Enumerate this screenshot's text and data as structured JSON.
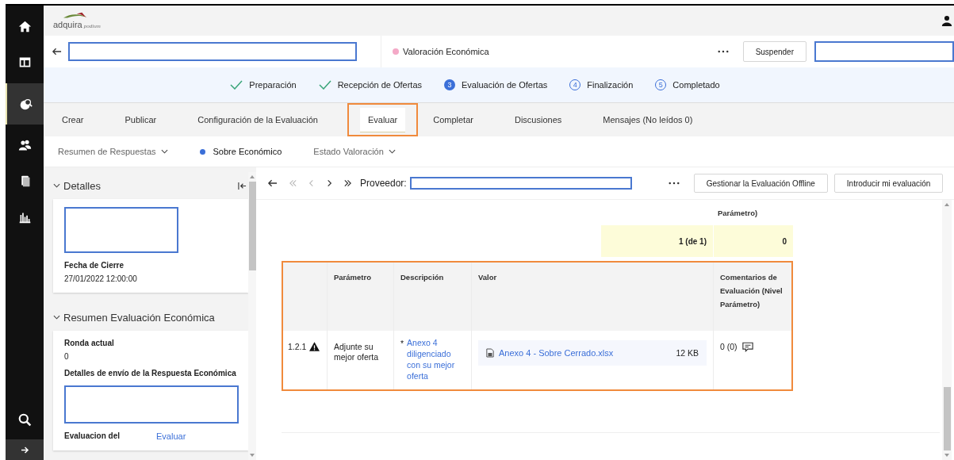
{
  "app": {
    "logo": "adquira",
    "logo_sub": "podium"
  },
  "header": {
    "status": "Valoración Económica",
    "suspend_button": "Suspender"
  },
  "steps": [
    {
      "label": "Preparación",
      "kind": "done"
    },
    {
      "label": "Recepción de Ofertas",
      "kind": "done"
    },
    {
      "number": "3",
      "label": "Evaluación de Ofertas",
      "kind": "current"
    },
    {
      "number": "4",
      "label": "Finalización",
      "kind": "pending"
    },
    {
      "number": "5",
      "label": "Completado",
      "kind": "pending"
    }
  ],
  "tabs": [
    {
      "label": "Crear",
      "selected": false,
      "highlight": false
    },
    {
      "label": "Publicar",
      "selected": false,
      "highlight": false
    },
    {
      "label": "Configuración de la Evaluación",
      "selected": false,
      "highlight": false
    },
    {
      "label": "Evaluar",
      "selected": true,
      "highlight": true
    },
    {
      "label": "Completar",
      "selected": false,
      "highlight": false
    },
    {
      "label": "Discusiones",
      "selected": false,
      "highlight": false
    },
    {
      "label": "Mensajes (No leídos 0)",
      "selected": false,
      "highlight": false
    }
  ],
  "subtabs": [
    {
      "label": "Resumen de Respuestas",
      "selected": false,
      "menu": true
    },
    {
      "label": "Sobre Económico",
      "selected": true,
      "menu": false
    },
    {
      "label": "Estado Valoración",
      "selected": false,
      "menu": true
    }
  ],
  "left_panel": {
    "sections": [
      {
        "title": "Detalles",
        "expanded": true,
        "fields": [
          {
            "kind": "redacted"
          },
          {
            "kind": "field",
            "label": "Fecha de Cierre",
            "value": "27/01/2022 12:00:00"
          }
        ]
      },
      {
        "title": "Resumen Evaluación Económica",
        "expanded": true,
        "fields": [
          {
            "kind": "field",
            "label": "Ronda actual",
            "value": "0"
          },
          {
            "kind": "field",
            "label": "Detalles de envío de la Respuesta Económica"
          },
          {
            "kind": "redacted"
          },
          {
            "kind": "link_field",
            "label": "Evaluacion del",
            "link": "Evaluar"
          }
        ]
      }
    ]
  },
  "toolbar": {
    "label": "Proveedor:",
    "buttons": [
      "Gestionar la Evaluación Offline",
      "Introducir mi evaluación"
    ]
  },
  "summary": {
    "header_fragment": "Parámetro)",
    "cells": [
      "1 (de 1)",
      "0"
    ]
  },
  "table": {
    "highlighted": true,
    "columns": [
      "Parámetro",
      "Descripción",
      "Valor",
      "Comentarios de Evaluación (Nivel Parámetro)"
    ],
    "rows": [
      {
        "id": "1.2.1",
        "warning": true,
        "parameter": "Adjunte su mejor oferta",
        "required_mark": "*",
        "description": "Anexo 4 diligenciado con su mejor oferta",
        "file": "Anexo 4 - Sobre Cerrado.xlsx",
        "size": "12 KB",
        "comments": "0 (0)"
      }
    ]
  }
}
